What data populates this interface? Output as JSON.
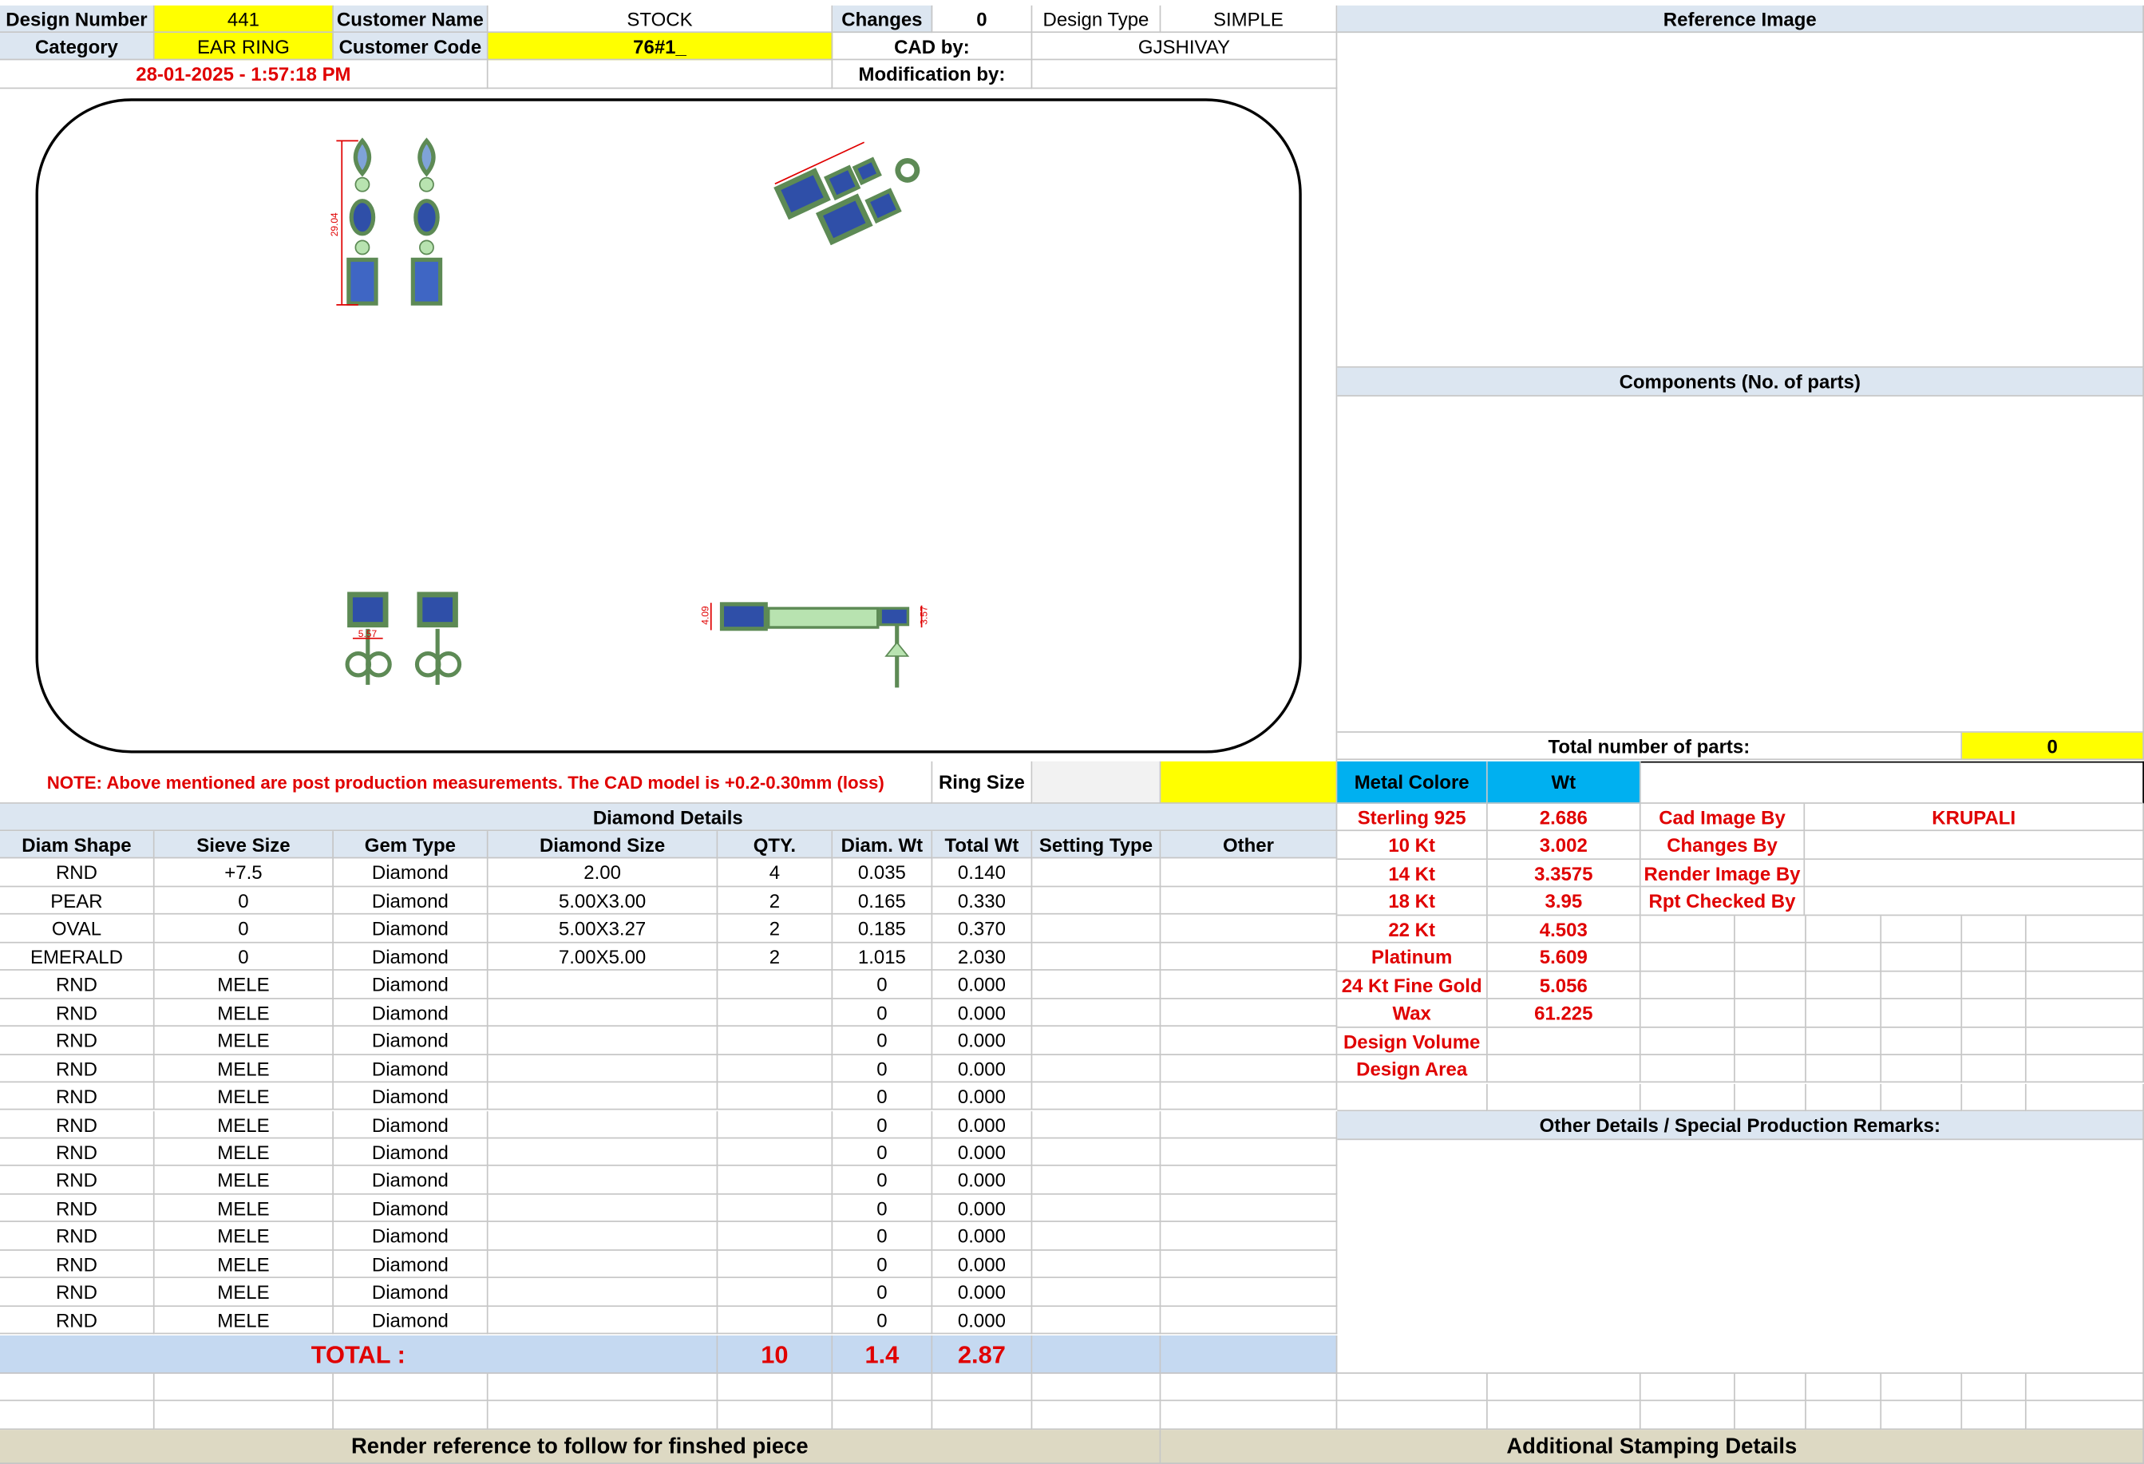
{
  "header": {
    "design_number_label": "Design Number",
    "design_number": "441",
    "customer_name_label": "Customer Name",
    "customer_name": "STOCK",
    "changes_label": "Changes",
    "changes": "0",
    "design_type_label": "Design Type",
    "design_type": "SIMPLE",
    "reference_image_label": "Reference Image",
    "category_label": "Category",
    "category": "EAR RING",
    "customer_code_label": "Customer Code",
    "customer_code": "76#1_",
    "cad_by_label": "CAD by:",
    "cad_by": "GJSHIVAY",
    "timestamp": "28-01-2025 - 1:57:18 PM",
    "modification_by_label": "Modification by:",
    "modification_by": ""
  },
  "drawing": {
    "dim_front_height": "29.04",
    "dim_top_width": "5.57",
    "dim_side_left": "4.09",
    "dim_side_right": "3.57"
  },
  "components": {
    "title": "Components (No. of parts)",
    "total_parts_label": "Total number of parts:",
    "total_parts": "0"
  },
  "note": {
    "text": "NOTE: Above mentioned are post production measurements. The CAD model is +0.2-0.30mm (loss)",
    "ring_size_label": "Ring Size",
    "ring_size": ""
  },
  "metal": {
    "col_label": "Metal Colore",
    "wt_label": "Wt",
    "rows": [
      {
        "name": "Sterling 925",
        "wt": "2.686"
      },
      {
        "name": "10 Kt",
        "wt": "3.002"
      },
      {
        "name": "14 Kt",
        "wt": "3.3575"
      },
      {
        "name": "18 Kt",
        "wt": "3.95"
      },
      {
        "name": "22 Kt",
        "wt": "4.503"
      },
      {
        "name": "Platinum",
        "wt": "5.609"
      },
      {
        "name": "24 Kt Fine Gold",
        "wt": "5.056"
      },
      {
        "name": "Wax",
        "wt": "61.225"
      },
      {
        "name": "Design Volume",
        "wt": ""
      },
      {
        "name": "Design Area",
        "wt": ""
      }
    ]
  },
  "credits": [
    {
      "label": "Cad Image By",
      "value": "KRUPALI"
    },
    {
      "label": "Changes By",
      "value": ""
    },
    {
      "label": "Render Image By",
      "value": ""
    },
    {
      "label": "Rpt Checked By",
      "value": ""
    }
  ],
  "diamond": {
    "title": "Diamond Details",
    "columns": [
      "Diam Shape",
      "Sieve Size",
      "Gem Type",
      "Diamond Size",
      "QTY.",
      "Diam. Wt",
      "Total Wt",
      "Setting Type",
      "Other"
    ],
    "rows": [
      [
        "RND",
        "+7.5",
        "Diamond",
        "2.00",
        "4",
        "0.035",
        "0.140",
        "",
        ""
      ],
      [
        "PEAR",
        "0",
        "Diamond",
        "5.00X3.00",
        "2",
        "0.165",
        "0.330",
        "",
        ""
      ],
      [
        "OVAL",
        "0",
        "Diamond",
        "5.00X3.27",
        "2",
        "0.185",
        "0.370",
        "",
        ""
      ],
      [
        "EMERALD",
        "0",
        "Diamond",
        "7.00X5.00",
        "2",
        "1.015",
        "2.030",
        "",
        ""
      ],
      [
        "RND",
        "MELE",
        "Diamond",
        "",
        "",
        "0",
        "0.000",
        "",
        ""
      ],
      [
        "RND",
        "MELE",
        "Diamond",
        "",
        "",
        "0",
        "0.000",
        "",
        ""
      ],
      [
        "RND",
        "MELE",
        "Diamond",
        "",
        "",
        "0",
        "0.000",
        "",
        ""
      ],
      [
        "RND",
        "MELE",
        "Diamond",
        "",
        "",
        "0",
        "0.000",
        "",
        ""
      ],
      [
        "RND",
        "MELE",
        "Diamond",
        "",
        "",
        "0",
        "0.000",
        "",
        ""
      ],
      [
        "RND",
        "MELE",
        "Diamond",
        "",
        "",
        "0",
        "0.000",
        "",
        ""
      ],
      [
        "RND",
        "MELE",
        "Diamond",
        "",
        "",
        "0",
        "0.000",
        "",
        ""
      ],
      [
        "RND",
        "MELE",
        "Diamond",
        "",
        "",
        "0",
        "0.000",
        "",
        ""
      ],
      [
        "RND",
        "MELE",
        "Diamond",
        "",
        "",
        "0",
        "0.000",
        "",
        ""
      ],
      [
        "RND",
        "MELE",
        "Diamond",
        "",
        "",
        "0",
        "0.000",
        "",
        ""
      ],
      [
        "RND",
        "MELE",
        "Diamond",
        "",
        "",
        "0",
        "0.000",
        "",
        ""
      ],
      [
        "RND",
        "MELE",
        "Diamond",
        "",
        "",
        "0",
        "0.000",
        "",
        ""
      ],
      [
        "RND",
        "MELE",
        "Diamond",
        "",
        "",
        "0",
        "0.000",
        "",
        ""
      ]
    ],
    "total_label": "TOTAL :",
    "total_qty": "10",
    "total_diam_wt": "1.4",
    "total_wt": "2.87"
  },
  "other_details_title": "Other Details / Special Production Remarks:",
  "footer": {
    "render_ref": "Render reference to follow for finshed piece",
    "stamping": "Additional Stamping Details"
  },
  "colors": {
    "label_bg": "#dce6f1",
    "highlight": "#ffff00",
    "accent_red": "#e00000",
    "metal_header": "#00b0f0",
    "footer_bg": "#ddd9c3",
    "gem_blue": "#2f4fa8",
    "metal_green": "#b8e3b0"
  }
}
